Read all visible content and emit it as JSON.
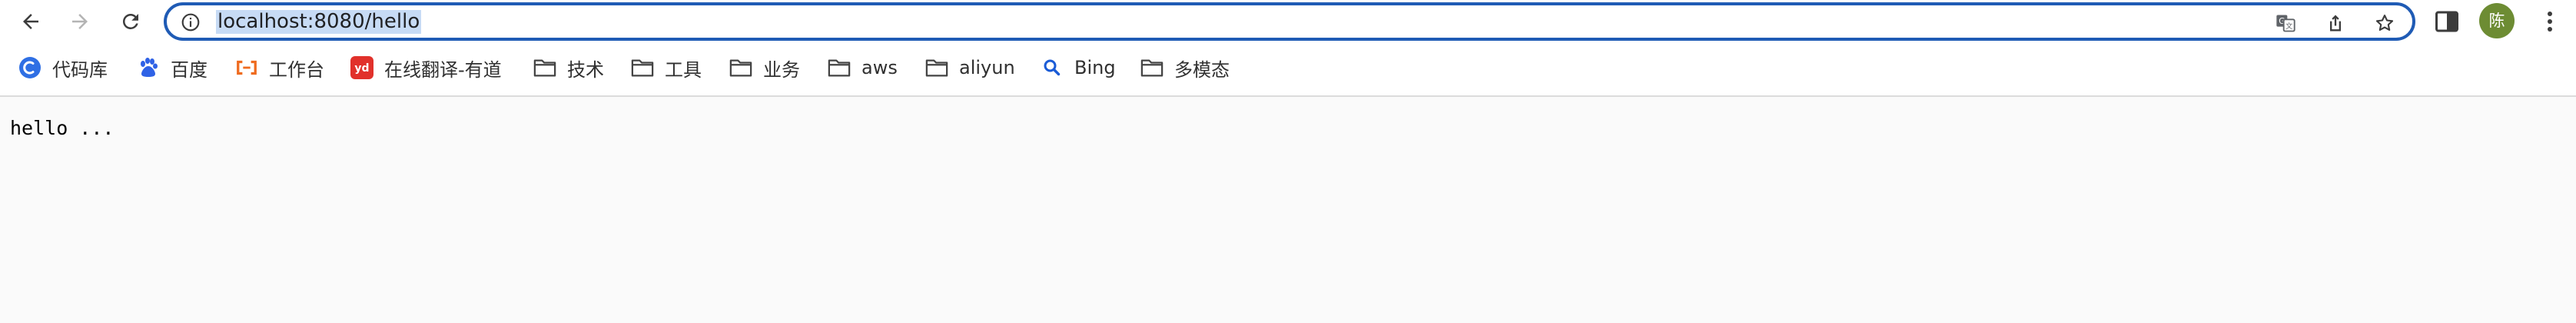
{
  "toolbar": {
    "back_icon": "arrow-left-icon",
    "forward_icon": "arrow-right-icon",
    "reload_icon": "reload-icon",
    "avatar_text": "陈",
    "avatar_color": "#6d8c33"
  },
  "omnibox": {
    "url": "localhost:8080/hello",
    "selection_color": "#c7dbf5",
    "border_color": "#1f5bb5"
  },
  "bookmarks": [
    {
      "label": "代码库",
      "icon": "code-repo-icon"
    },
    {
      "label": "百度",
      "icon": "baidu-icon"
    },
    {
      "label": "工作台",
      "icon": "workbench-icon"
    },
    {
      "label": "在线翻译-有道",
      "icon": "youdao-icon"
    },
    {
      "label": "技术",
      "icon": "folder-icon"
    },
    {
      "label": "工具",
      "icon": "folder-icon"
    },
    {
      "label": "业务",
      "icon": "folder-icon"
    },
    {
      "label": "aws",
      "icon": "folder-icon"
    },
    {
      "label": "aliyun",
      "icon": "folder-icon"
    },
    {
      "label": "Bing",
      "icon": "search-icon"
    },
    {
      "label": "多模态",
      "icon": "folder-icon"
    }
  ],
  "page": {
    "body_text": "hello ..."
  }
}
